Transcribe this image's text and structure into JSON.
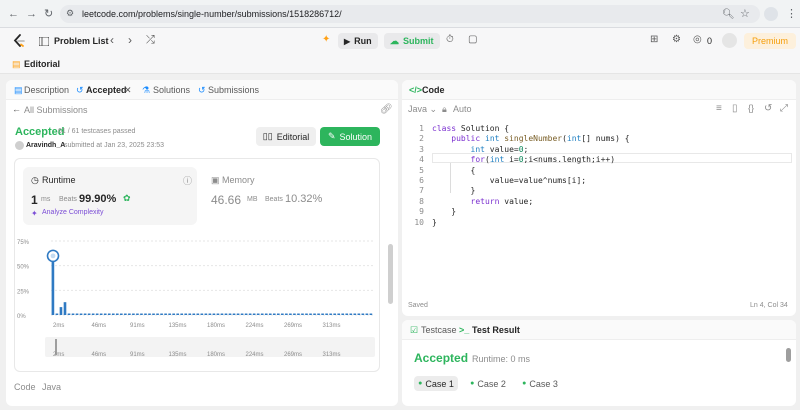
{
  "browser": {
    "url": "leetcode.com/problems/single-number/submissions/1518286712/"
  },
  "header": {
    "problem_list": "Problem List",
    "run": "Run",
    "submit": "Submit",
    "coins": "0",
    "premium": "Premium"
  },
  "editorial_bar": {
    "label": "Editorial"
  },
  "left": {
    "tabs": [
      {
        "label": "Description"
      },
      {
        "label": "Accepted"
      },
      {
        "label": "Solutions"
      },
      {
        "label": "Submissions"
      }
    ],
    "back_label": "All Submissions",
    "status": "Accepted",
    "testcases": "61 / 61 testcases passed",
    "author": "Aravindh_A",
    "submitted": "submitted at Jan 23, 2025 23:53",
    "editorial_btn": "Editorial",
    "solution_btn": "Solution",
    "runtime": {
      "title": "Runtime",
      "value": "1",
      "unit": "ms",
      "beats_label": "Beats",
      "beats": "99.90%",
      "analyze": "Analyze Complexity"
    },
    "memory": {
      "title": "Memory",
      "value": "46.66",
      "unit": "MB",
      "beats_label": "Beats",
      "beats": "10.32%"
    },
    "footer_code": "Code",
    "footer_lang": "Java"
  },
  "chart_data": {
    "type": "bar",
    "y_ticks": [
      "75%",
      "50%",
      "25%",
      "0%"
    ],
    "ylim": [
      0,
      75
    ],
    "x_ticks": [
      "2ms",
      "46ms",
      "91ms",
      "135ms",
      "180ms",
      "224ms",
      "269ms",
      "313ms"
    ],
    "range_ticks": [
      "2ms",
      "46ms",
      "91ms",
      "135ms",
      "180ms",
      "224ms",
      "269ms",
      "313ms"
    ],
    "values": [
      66,
      1.5,
      8,
      13,
      1.5,
      1.5,
      1.5,
      1.5,
      1.5,
      1.5,
      1.5,
      1.5,
      1.5,
      1.5,
      1.5,
      1.5,
      1.5,
      1.5,
      1.5,
      1.5,
      1.5,
      1.5,
      1.5,
      1.5,
      1.5,
      1.5,
      1.5,
      1.5,
      1.5,
      1.5,
      1.5,
      1.5,
      1.5,
      1.5,
      1.5,
      1.5,
      1.5,
      1.5,
      1.5,
      1.5,
      1.5,
      1.5,
      1.5,
      1.5,
      1.5,
      1.5,
      1.5,
      1.5,
      1.5,
      1.5,
      1.5,
      1.5,
      1.5,
      1.5,
      1.5,
      1.5,
      1.5,
      1.5,
      1.5,
      1.5,
      1.5,
      1.5,
      1.5,
      1.5,
      1.5,
      1.5,
      1.5,
      1.5,
      1.5,
      1.5,
      1.5,
      1.5,
      1.5,
      1.5,
      1.5,
      1.5,
      1.5,
      1.5,
      1.5,
      1.5
    ],
    "highlight_index": 0
  },
  "code_panel": {
    "title": "Code",
    "lang": "Java",
    "auto": "Auto",
    "saved": "Saved",
    "cursor": "Ln 4, Col 34",
    "lines": [
      {
        "n": "1",
        "text": "class Solution {"
      },
      {
        "n": "2",
        "text": "    public int singleNumber(int[] nums) {"
      },
      {
        "n": "3",
        "text": "        int value=0;"
      },
      {
        "n": "4",
        "text": "        for(int i=0;i<nums.length;i++)"
      },
      {
        "n": "5",
        "text": "        {"
      },
      {
        "n": "6",
        "text": "            value=value^nums[i];"
      },
      {
        "n": "7",
        "text": "        }"
      },
      {
        "n": "8",
        "text": "        return value;"
      },
      {
        "n": "9",
        "text": "    }"
      },
      {
        "n": "10",
        "text": "}"
      }
    ]
  },
  "result_panel": {
    "tab_testcase": "Testcase",
    "tab_result": "Test Result",
    "status": "Accepted",
    "runtime": "Runtime: 0 ms",
    "cases": [
      "Case 1",
      "Case 2",
      "Case 3"
    ]
  },
  "colors": {
    "accent_green": "#2db55d",
    "bar_blue": "#2f7ac3",
    "premium_orange": "#f59e0b"
  }
}
